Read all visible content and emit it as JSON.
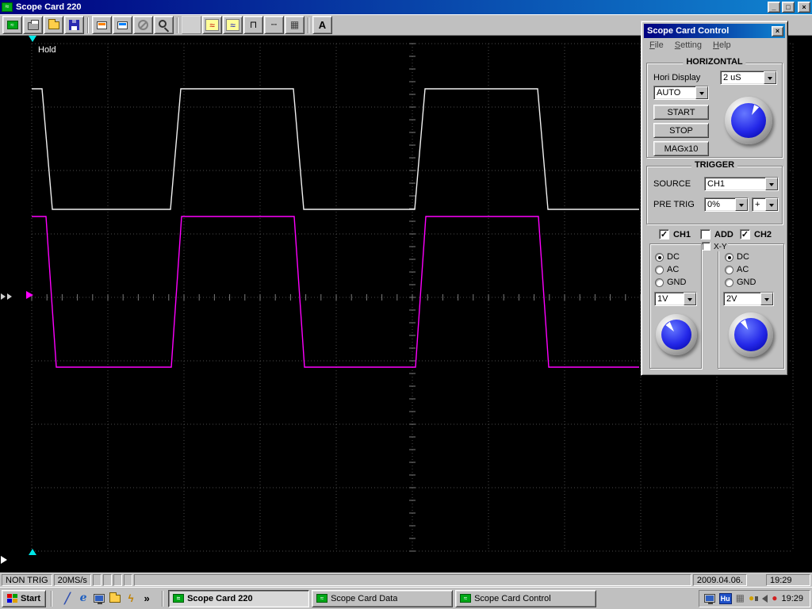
{
  "main_window": {
    "title": "Scope Card 220",
    "titlebar": {
      "minimize": "_",
      "maximize": "□",
      "close": "×"
    }
  },
  "toolbar": {
    "buttons": [
      {
        "name": "scope-device-button",
        "icon": "card-green",
        "icon_name": "scope-card-icon"
      },
      {
        "name": "print-button",
        "icon": "printer",
        "icon_name": "printer-icon"
      },
      {
        "name": "open-button",
        "icon": "folder",
        "icon_name": "open-folder-icon"
      },
      {
        "name": "save-button",
        "icon": "floppy",
        "icon_name": "save-icon"
      },
      {
        "sep": true
      },
      {
        "name": "scope-card-a-button",
        "icon": "card-white",
        "icon_name": "scope-card-a-icon"
      },
      {
        "name": "scope-card-b-button",
        "icon": "card-white2",
        "icon_name": "scope-card-b-icon"
      },
      {
        "name": "disable-button",
        "icon": "no",
        "icon_name": "disabled-icon"
      },
      {
        "name": "zoom-button",
        "icon": "zoom",
        "icon_name": "zoom-icon"
      },
      {
        "sep": true
      },
      {
        "name": "blank-button",
        "glyph": "",
        "icon_name": "blank-icon",
        "disabled": true
      },
      {
        "name": "sine-wave-button",
        "glyph": "≈",
        "fg": "#c00000",
        "bg": "#ffff99",
        "icon_name": "sine-wave-icon"
      },
      {
        "name": "wave-2-button",
        "glyph": "≈",
        "fg": "#0000c0",
        "bg": "#ffff99",
        "icon_name": "wave-icon"
      },
      {
        "name": "square-wave-button",
        "glyph": "⊓",
        "fg": "#000000",
        "icon_name": "square-wave-icon"
      },
      {
        "name": "dashed-line-button",
        "glyph": "┄",
        "fg": "#000000",
        "icon_name": "dashed-line-icon"
      },
      {
        "name": "grid-x-button",
        "glyph": "▦",
        "fg": "#404040",
        "icon_name": "grid-icon"
      },
      {
        "sep": true
      },
      {
        "name": "text-label-button",
        "glyph": "A",
        "fg": "#000000",
        "bold": true,
        "icon_name": "text-label-icon"
      }
    ]
  },
  "scope": {
    "hold_label": "Hold",
    "colors": {
      "background": "#000000",
      "grid": "#4a4a4a",
      "ticks": "#7a7a7a",
      "ch1": "#f0f0f0",
      "ch2": "#ff00ff",
      "marker_cyan": "#00e8e8",
      "marker_magenta": "#ff00ff"
    },
    "ch1_points": [
      [
        40,
        112
      ],
      [
        53,
        112
      ],
      [
        66,
        264
      ],
      [
        215,
        264
      ],
      [
        228,
        112
      ],
      [
        370,
        112
      ],
      [
        383,
        264
      ],
      [
        523,
        264
      ],
      [
        536,
        112
      ],
      [
        678,
        112
      ],
      [
        691,
        264
      ],
      [
        806,
        264
      ]
    ],
    "ch2_points": [
      [
        40,
        273
      ],
      [
        58,
        273
      ],
      [
        71,
        463
      ],
      [
        216,
        463
      ],
      [
        229,
        273
      ],
      [
        371,
        273
      ],
      [
        384,
        463
      ],
      [
        524,
        463
      ],
      [
        537,
        273
      ],
      [
        679,
        273
      ],
      [
        692,
        463
      ],
      [
        806,
        463
      ]
    ]
  },
  "control_window": {
    "title": "Scope Card Control",
    "close_glyph": "×",
    "menu": [
      "File",
      "Setting",
      "Help"
    ],
    "horizontal": {
      "title": "HORIZONTAL",
      "hori_display_label": "Hori Display",
      "timebase_value": "2 uS",
      "mode_value": "AUTO",
      "start_label": "START",
      "stop_label": "STOP",
      "mag_label": "MAGx10",
      "knob_angle": 28
    },
    "trigger": {
      "title": "TRIGGER",
      "source_label": "SOURCE",
      "source_value": "CH1",
      "pretrig_label": "PRE TRIG",
      "pretrig_value": "0%",
      "slope_value": "+"
    },
    "channels": {
      "ch1": {
        "label": "CH1",
        "enabled": true,
        "coupling_options": [
          "DC",
          "AC",
          "GND"
        ],
        "coupling": "DC",
        "volts_value": "1V",
        "knob_angle": -38
      },
      "add": {
        "label": "ADD",
        "enabled": false,
        "xy_label": "X-Y",
        "xy_enabled": false
      },
      "ch2": {
        "label": "CH2",
        "enabled": true,
        "coupling_options": [
          "DC",
          "AC",
          "GND"
        ],
        "coupling": "DC",
        "volts_value": "2V",
        "knob_angle": -30
      }
    }
  },
  "statusbar": {
    "trigger_status": "NON TRIG",
    "sample_rate": "20MS/s",
    "date": "2009.04.06.",
    "time": "19:29"
  },
  "taskbar": {
    "start_label": "Start",
    "quick_launch": [
      {
        "name": "quicklaunch-pen",
        "glyph": "╱",
        "fg": "#3050b0",
        "icon_name": "pen-icon"
      },
      {
        "name": "quicklaunch-ie",
        "glyph": "e",
        "fg": "#2060c0",
        "class": "ie",
        "icon_name": "browser-icon"
      },
      {
        "name": "quicklaunch-desktop",
        "icon": "monitor",
        "icon_name": "show-desktop-icon"
      },
      {
        "name": "quicklaunch-folder",
        "icon": "folder",
        "icon_name": "folder-icon"
      },
      {
        "name": "quicklaunch-flash",
        "glyph": "ϟ",
        "fg": "#c08000",
        "icon_name": "flash-icon"
      },
      {
        "name": "quicklaunch-more",
        "glyph": "»",
        "fg": "#000000",
        "icon_name": "chevron-more-icon"
      }
    ],
    "tasks": [
      {
        "label": "Scope Card 220",
        "active": true
      },
      {
        "label": "Scope Card Data",
        "active": false
      },
      {
        "label": "Scope Card Control",
        "active": false
      }
    ],
    "tray": [
      {
        "name": "tray-display-icon",
        "icon": "monitor",
        "icon_name": "display-icon"
      },
      {
        "name": "language-indicator",
        "text": "Hu",
        "icon_name": "language-indicator"
      },
      {
        "name": "tray-app-icon-1",
        "glyph": "▦",
        "fg": "#606060",
        "icon_name": "tray-app-icon"
      },
      {
        "name": "tray-app-icon-2",
        "glyph": "●",
        "fg": "#d0a000",
        "icon_name": "tray-app-icon"
      },
      {
        "name": "tray-volume-icon",
        "icon": "speaker",
        "icon_name": "volume-icon"
      },
      {
        "name": "tray-app-icon-3",
        "glyph": "●",
        "fg": "#d02020",
        "icon_name": "tray-app-icon"
      }
    ],
    "clock": "19:29"
  }
}
